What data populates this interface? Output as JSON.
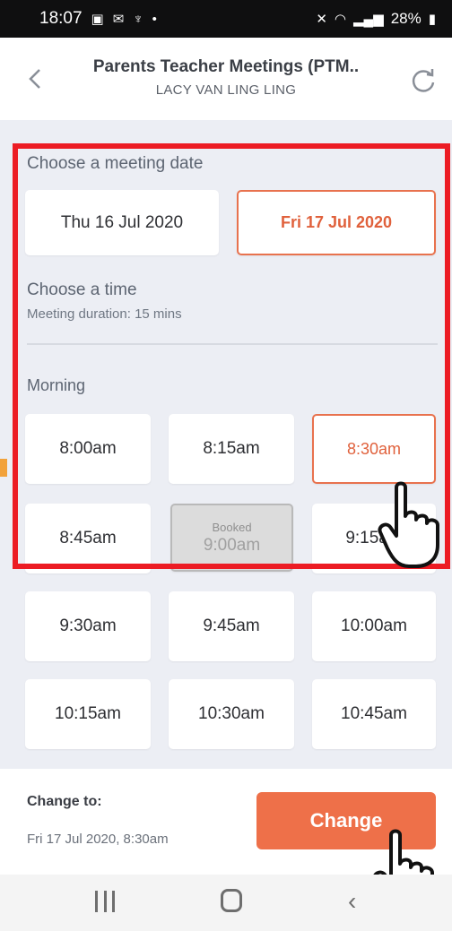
{
  "status_bar": {
    "time": "18:07",
    "battery": "28%"
  },
  "header": {
    "title": "Parents Teacher Meetings (PTM..",
    "subtitle": "LACY VAN LING LING"
  },
  "date_section": {
    "label": "Choose a meeting date",
    "dates": [
      {
        "label": "Thu 16 Jul 2020",
        "selected": false
      },
      {
        "label": "Fri 17 Jul 2020",
        "selected": true
      }
    ]
  },
  "time_section": {
    "label": "Choose a time",
    "duration_note": "Meeting duration: 15 mins",
    "period_label": "Morning",
    "booked_label": "Booked",
    "slots": [
      {
        "time": "8:00am",
        "state": "available"
      },
      {
        "time": "8:15am",
        "state": "available"
      },
      {
        "time": "8:30am",
        "state": "selected"
      },
      {
        "time": "8:45am",
        "state": "available"
      },
      {
        "time": "9:00am",
        "state": "booked"
      },
      {
        "time": "9:15am",
        "state": "available"
      },
      {
        "time": "9:30am",
        "state": "available"
      },
      {
        "time": "9:45am",
        "state": "available"
      },
      {
        "time": "10:00am",
        "state": "available"
      },
      {
        "time": "10:15am",
        "state": "available"
      },
      {
        "time": "10:30am",
        "state": "available"
      },
      {
        "time": "10:45am",
        "state": "available"
      }
    ]
  },
  "footer": {
    "change_to_label": "Change to:",
    "change_to_value": "Fri 17 Jul 2020, 8:30am",
    "change_button": "Change"
  },
  "colors": {
    "accent": "#ee7049",
    "highlight_box": "#ec1c24",
    "background": "#eceef4"
  },
  "icons": [
    "back-chevron-icon",
    "refresh-icon",
    "nav-recents-icon",
    "nav-home-icon",
    "nav-back-icon",
    "pointing-hand-icon"
  ]
}
